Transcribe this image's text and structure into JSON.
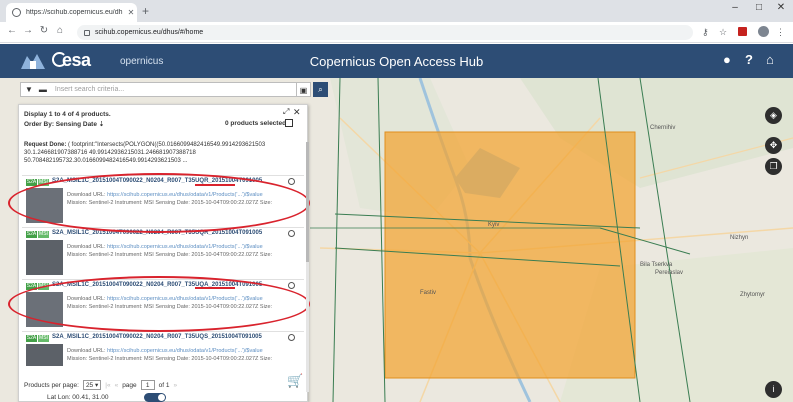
{
  "browser": {
    "tab_title": "https://scihub.copernicus.eu/dh",
    "url": "scihub.copernicus.eu/dhus/#/home",
    "new_tab_icon": "plus-icon"
  },
  "header": {
    "brand": "esa",
    "sub_brand": "opernicus",
    "title": "Copernicus Open Access Hub",
    "bg_color": "#2d4d75"
  },
  "search": {
    "placeholder": "Insert search criteria..."
  },
  "results": {
    "display_text": "Display 1 to 4 of 4 products.",
    "order_label": "Order By: Sensing Date",
    "selected_text": "0 products selected",
    "request_label": "Request Done:",
    "request_text": "( footprint:\"Intersects(POLYGON((50.0166099482416549.9914293621503 30.1.246681907388716 49.99142936215031.246681907388718 50.708482195732.30.0166099482416549.9914293621503 ...",
    "items": [
      {
        "title": "S2A_MSIL1C_20151004T090022_N0204_R007_T35UQR_20151004T091005",
        "badge1": "S2A",
        "badge2": "MSI",
        "download_label": "Download URL:",
        "download_url": "https://scihub.copernicus.eu/dhus/odata/v1/Products('...')/$value",
        "meta": "Mission: Sentinel-2 Instrument: MSI Sensing Date: 2015-10-04T09:00:22.027Z Size:"
      },
      {
        "title": "S2A_MSIL1C_20151004T090022_N0204_R007_T35UQR_20151004T091005",
        "badge1": "S2A",
        "badge2": "MSI",
        "download_label": "Download URL:",
        "download_url": "https://scihub.copernicus.eu/dhus/odata/v1/Products('...')/$value",
        "meta": "Mission: Sentinel-2 Instrument: MSI Sensing Date: 2015-10-04T09:00:22.027Z Size:"
      },
      {
        "title": "S2A_MSIL1C_20151004T090022_N0204_R007_T35UQA_20151004T091005",
        "badge1": "S2A",
        "badge2": "MSI",
        "download_label": "Download URL:",
        "download_url": "https://scihub.copernicus.eu/dhus/odata/v1/Products('...')/$value",
        "meta": "Mission: Sentinel-2 Instrument: MSI Sensing Date: 2015-10-04T09:00:22.027Z Size:"
      },
      {
        "title": "S2A_MSIL1C_20151004T090022_N0204_R007_T35UQS_20151004T091005",
        "badge1": "S2A",
        "badge2": "MSI",
        "download_label": "Download URL:",
        "download_url": "https://scihub.copernicus.eu/dhus/odata/v1/Products('...')/$value",
        "meta": "Mission: Sentinel-2 Instrument: MSI Sensing Date: 2015-10-04T09:00:22.027Z Size:"
      }
    ]
  },
  "pager": {
    "label": "Products per page:",
    "per_page": "25",
    "page_label": "page",
    "page": "1",
    "of_label": "of 1"
  },
  "footer": {
    "latlon": "Lat Lon: 00.41, 31.00"
  },
  "map": {
    "places": [
      "Chernihiv",
      "Kyiv",
      "Bila Tserkva",
      "Fastiv",
      "Pereiaslav",
      "Zhytomyr",
      "Nizhyn"
    ]
  },
  "colors": {
    "footprint": "#f2a431",
    "highlight": "#d9232d",
    "tile_lines": "#3a7d52"
  }
}
